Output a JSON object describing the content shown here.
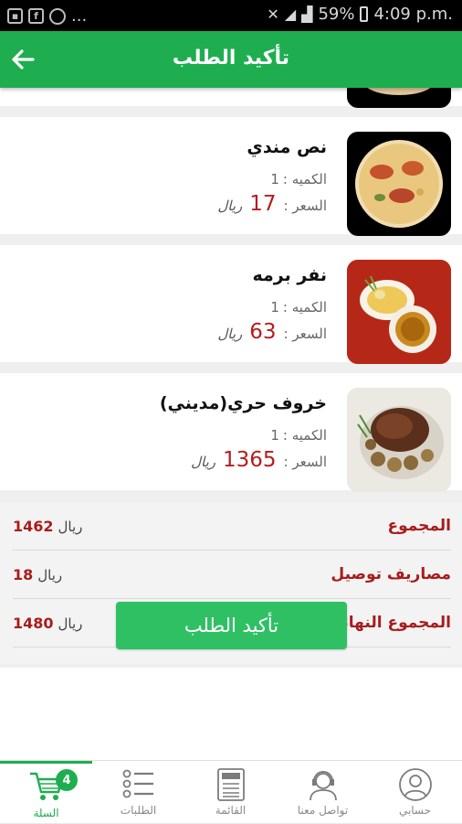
{
  "status_bar": {
    "notif_icons": [
      "image-icon",
      "facebook-icon",
      "app-icon"
    ],
    "ellipsis": "...",
    "battery": "59%",
    "time": "4:09 p.m."
  },
  "header": {
    "title": "تأكيد الطلب"
  },
  "cart_items": [
    {
      "name": "نص مندي",
      "qty_label": "الكميه :",
      "qty": "1",
      "price_label": "السعر :",
      "price": "17",
      "currency": "ريال"
    },
    {
      "name": "نفر برمه",
      "qty_label": "الكميه :",
      "qty": "1",
      "price_label": "السعر :",
      "price": "63",
      "currency": "ريال"
    },
    {
      "name": "خروف حري(مديني)",
      "qty_label": "الكميه :",
      "qty": "1",
      "price_label": "السعر :",
      "price": "1365",
      "currency": "ريال"
    }
  ],
  "summary": {
    "subtotal_label": "المجموع",
    "subtotal": "1462",
    "subtotal_currency": "ريال",
    "delivery_label": "مصاريف توصيل",
    "delivery": "18",
    "delivery_currency": "ريال",
    "total_label": "المجموع النهائى",
    "total": "1480",
    "total_currency": "ريال"
  },
  "confirm_button": "تأكيد الطلب",
  "bottom_nav": {
    "cart_label": "السلة",
    "cart_badge": "4",
    "orders_label": "الطلبات",
    "menu_label": "القائمة",
    "menu_icon_text": "MENU",
    "contact_label": "تواصل معنا",
    "account_label": "حسابي"
  },
  "colors": {
    "primary": "#1eae4f",
    "button": "#2fc064",
    "price": "#b51d1d"
  }
}
